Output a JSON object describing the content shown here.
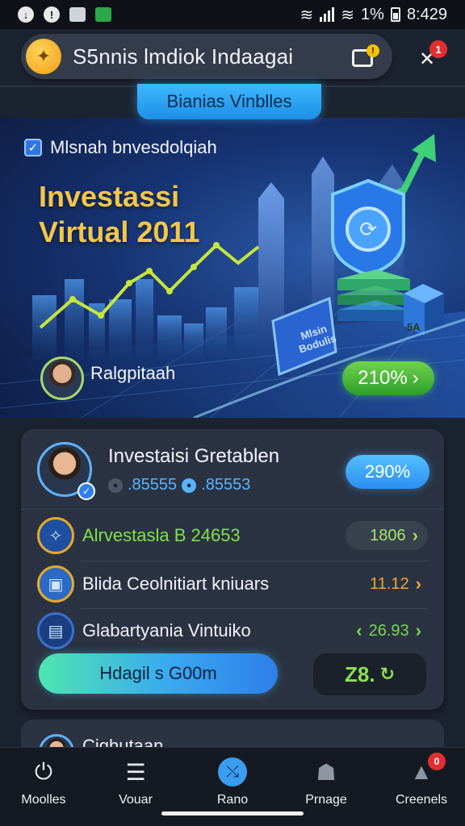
{
  "status_bar": {
    "battery": "1%",
    "time": "8:429"
  },
  "header": {
    "app_title": "S5nnis lmdiok Indaagai",
    "notification_count": "1"
  },
  "tab": {
    "label": "Bianias Vinblles"
  },
  "banner": {
    "subtitle": "Mlsnah bnvesdolqiah",
    "title": "Investassi Virtual 2011",
    "panel_text": "Mlsin Bodulis",
    "cube_text": "5A",
    "user_name": "Ralgpitaah",
    "percent": "210%"
  },
  "card": {
    "title": "Investaisi Gretablen",
    "stat_a": ".85555",
    "stat_b": ".85553",
    "badge": "290%",
    "rows": [
      {
        "label": "Alrvestasla B 24653",
        "value": "1806"
      },
      {
        "label": "Blida Ceolnitiart kniuars",
        "value": "11.12"
      },
      {
        "label": "Glabartyania Vintuiko",
        "value": "26.93"
      }
    ],
    "cta_label": "Hdagil s G00m",
    "total_value": "Z8."
  },
  "card2": {
    "title": "Cighutaan"
  },
  "nav": {
    "items": [
      {
        "label": "Moolles"
      },
      {
        "label": "Vouar"
      },
      {
        "label": "Rano"
      },
      {
        "label": "Prnage"
      },
      {
        "label": "Creenels"
      }
    ],
    "badge": "0"
  },
  "colors": {
    "background": "#1c2330",
    "accent_blue": "#3a9df0",
    "accent_green": "#6fd34b",
    "gold": "#f3c649",
    "orange": "#f3a62b"
  }
}
